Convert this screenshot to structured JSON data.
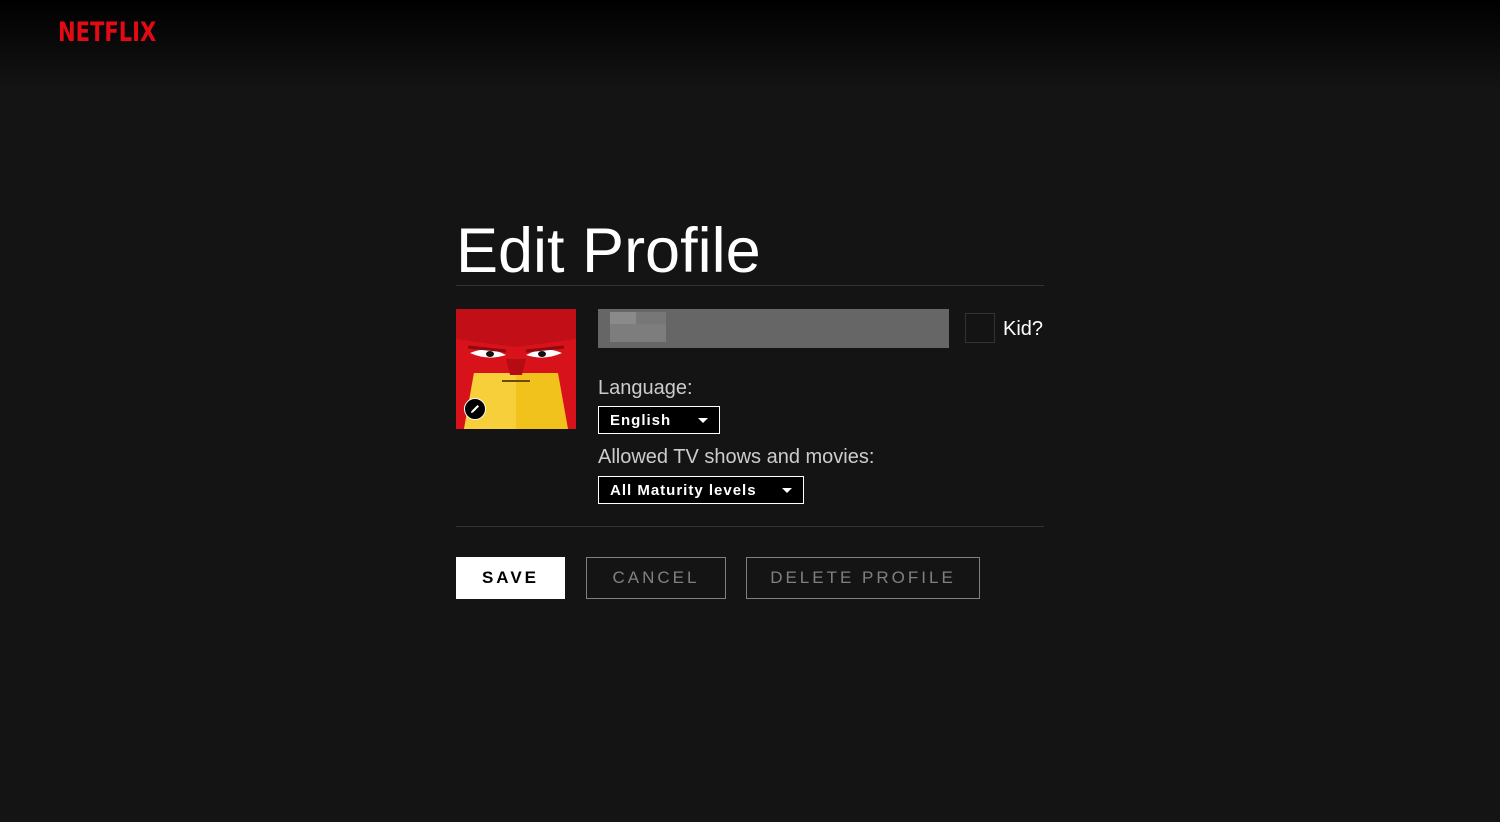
{
  "header": {
    "logo_text": "NETFLIX"
  },
  "page": {
    "title": "Edit Profile"
  },
  "profile": {
    "avatar_icon": "red-character-avatar",
    "edit_icon": "pencil-icon",
    "name_value": "",
    "kid_label": "Kid?",
    "kid_checked": false
  },
  "language": {
    "label": "Language:",
    "selected": "English"
  },
  "maturity": {
    "label": "Allowed TV shows and movies:",
    "selected": "All Maturity levels"
  },
  "actions": {
    "save_label": "SAVE",
    "cancel_label": "CANCEL",
    "delete_label": "DELETE PROFILE"
  },
  "colors": {
    "brand": "#e50914",
    "background": "#141414"
  }
}
